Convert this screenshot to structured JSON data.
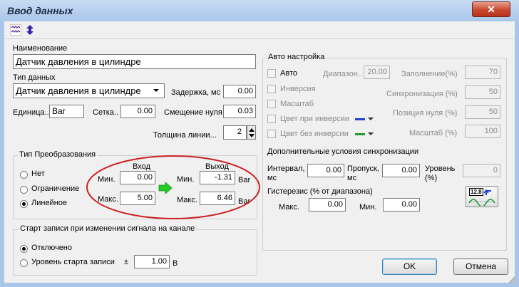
{
  "window": {
    "title": "Ввод данных",
    "close_symbol": "✕"
  },
  "left": {
    "name_label": "Наименование",
    "name_value": "Датчик давления в цилиндре",
    "type_label": "Тип данных",
    "type_value": "Датчик давления в цилиндре",
    "delay_label": "Задержка, мс",
    "delay_value": "0.00",
    "unit_label": "Единица..",
    "unit_value": "Bar",
    "grid_label": "Сетка..",
    "grid_value": "0.00",
    "zero_offset_label": "Смещение нуля",
    "zero_offset_value": "0.03",
    "line_width_label": "Толщина линии...",
    "line_width_value": "2"
  },
  "conversion": {
    "group_label": "Тип Преобразования",
    "options": [
      "Нет",
      "Ограничение",
      "Линейное"
    ],
    "selected": "Линейное",
    "input_header": "Вход",
    "output_header": "Выход",
    "min_label": "Мин.",
    "max_label": "Макс.",
    "in_min": "0.00",
    "in_max": "5.00",
    "out_min": "-1.31",
    "out_max": "6.46",
    "out_unit_min": "Bar",
    "out_unit_max": "Bar"
  },
  "record_start": {
    "group_label": "Старт записи при изменении сигнала на канале",
    "options": [
      "Отключено",
      "Уровень старта записи"
    ],
    "selected": "Отключено",
    "pm": "±",
    "level_value": "1.00",
    "level_unit": "В"
  },
  "auto": {
    "group_label": "Авто настройка",
    "auto_label": "Авто",
    "inversion_label": "Инверсия",
    "scale_label": "Масштаб",
    "inv_color_label": "Цвет при инверсии",
    "no_inv_color_label": "Цвет без инверсии",
    "range_label": "Диапазон..",
    "range_value": "20.00",
    "fill_label": "Заполнение(%)",
    "fill_value": "70",
    "sync_label": "Синхронизация (%)",
    "sync_value": "50",
    "zero_pos_label": "Позиция нуля (%)",
    "zero_pos_value": "50",
    "scale2_label": "Масштаб (%)",
    "scale2_value": "100",
    "inv_color": "#1f3fd0",
    "no_inv_color": "#1e9a2e"
  },
  "sync": {
    "section_label": "Дополнительные условия синхронизации",
    "interval_label1": "Интервал,",
    "interval_label2": "мс",
    "interval_value": "0.00",
    "skip_label1": "Пропуск,",
    "skip_label2": "мс",
    "skip_value": "0.00",
    "level_label1": "Уровень",
    "level_label2": "(%)",
    "level_value": "0",
    "hysteresis_label": "Гистерезис (% от диапазона)",
    "max_label": "Макс.",
    "max_value": "0.00",
    "min_label": "Мин.",
    "min_value": "0.00",
    "calc_icon_text": "12.8"
  },
  "buttons": {
    "ok": "OK",
    "cancel": "Отмена"
  },
  "colors": {
    "accent_green": "#22cc22",
    "annotation_red": "#cc2222"
  }
}
